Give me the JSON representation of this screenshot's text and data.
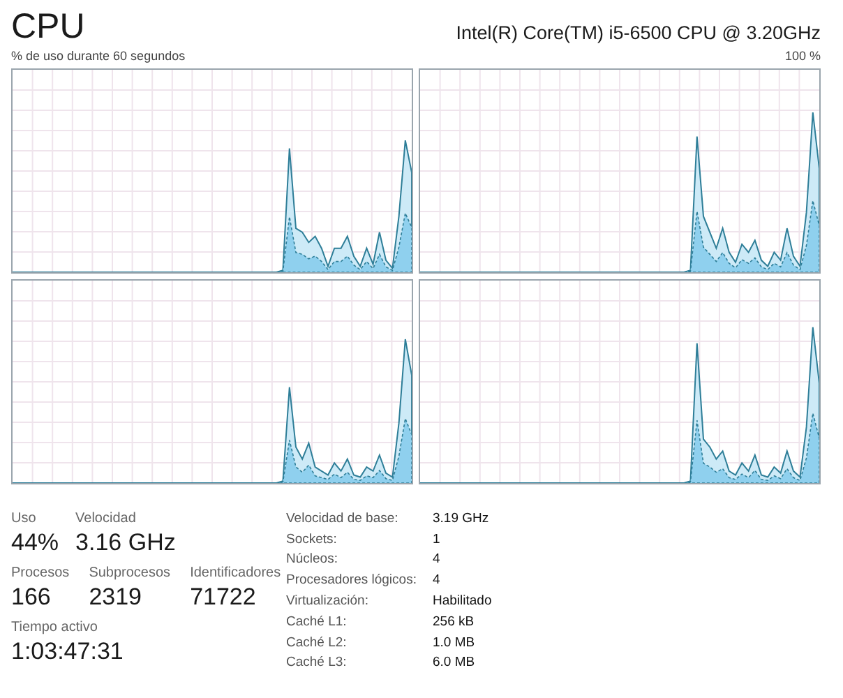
{
  "title": "CPU",
  "processor": "Intel(R) Core(TM) i5-6500 CPU @ 3.20GHz",
  "graph_caption": "% de uso durante 60 segundos",
  "graph_max": "100 %",
  "graphs": [
    {
      "kind": "logical_processor"
    },
    {
      "kind": "logical_processor"
    },
    {
      "kind": "logical_processor"
    },
    {
      "kind": "logical_processor"
    }
  ],
  "stat_rows": [
    [
      {
        "label": "Uso",
        "value": "44%"
      },
      {
        "label": "Velocidad",
        "value": "3.16 GHz"
      }
    ],
    [
      {
        "label": "Procesos",
        "value": "166"
      },
      {
        "label": "Subprocesos",
        "value": "2319"
      },
      {
        "label": "Identificadores",
        "value": "71722"
      }
    ],
    [
      {
        "label": "Tiempo activo",
        "value": "1:03:47:31"
      }
    ]
  ],
  "details": [
    {
      "label": "Velocidad de base:",
      "value": "3.19 GHz"
    },
    {
      "label": "Sockets:",
      "value": "1"
    },
    {
      "label": "Núcleos:",
      "value": "4"
    },
    {
      "label": "Procesadores lógicos:",
      "value": "4"
    },
    {
      "label": "Virtualización:",
      "value": "Habilitado"
    },
    {
      "label": "Caché L1:",
      "value": "256 kB"
    },
    {
      "label": "Caché L2:",
      "value": "1.0 MB"
    },
    {
      "label": "Caché L3:",
      "value": "6.0 MB"
    }
  ]
}
